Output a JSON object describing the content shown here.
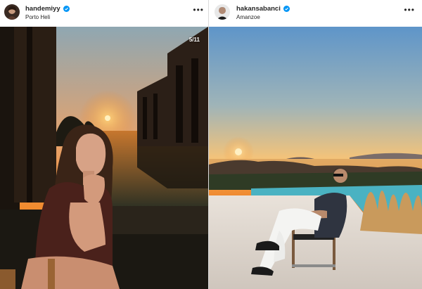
{
  "posts": [
    {
      "username": "handemiyy",
      "verified": true,
      "location": "Porto Heli",
      "counter": "5/11",
      "avatar_icon": "profile-avatar",
      "more_icon": "more-options-icon"
    },
    {
      "username": "hakansabanci",
      "verified": true,
      "location": "Amanzoe",
      "avatar_icon": "profile-avatar",
      "more_icon": "more-options-icon"
    }
  ],
  "colors": {
    "verified_blue": "#0095f6",
    "text": "#262626",
    "divider": "#dbdbdb"
  }
}
